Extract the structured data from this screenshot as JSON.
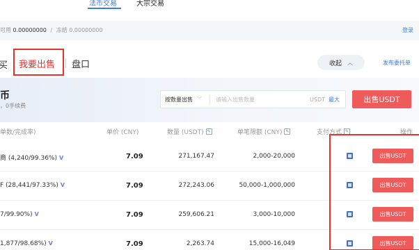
{
  "top_tabs": {
    "fiat": "法币交易",
    "bulk": "大宗交易"
  },
  "balance": {
    "available_label": "可用",
    "available_value": "0.00000000",
    "separator": "/",
    "frozen_label": "冻结",
    "frozen_value": "0.00000000",
    "record_link": "登录"
  },
  "mode_tabs": {
    "left_cut": "买",
    "sell": "我要出售",
    "book": "盘口"
  },
  "collapse": {
    "label": "收起",
    "icon": "chevron-up"
  },
  "post_order": "发布委托单",
  "coin": {
    "name": "币",
    "fee_text": "，0手续费"
  },
  "sell_form": {
    "type_label": "按数量出售",
    "amount_placeholder": "请输入出售数量",
    "unit": "USDT",
    "max_label": "最大",
    "submit_label": "出售USDT"
  },
  "table": {
    "headers": {
      "merchant": "单数/完成率)",
      "price": "单价 (CNY)",
      "amount": "数量 (USDT)",
      "limit": "单笔限额 (CNY)",
      "payment": "支付方式",
      "action": "操作"
    },
    "rows": [
      {
        "merchant": "商 (4,240/99.36%)",
        "verified": "V",
        "price": "7.09",
        "amount": "271,167.47",
        "limit": "2,000-20,000",
        "action": "出售USDT"
      },
      {
        "merchant": "F (28,441/97.33%)",
        "verified": "V",
        "price": "7.09",
        "amount": "272,243.06",
        "limit": "50,000-1,000,000",
        "action": "出售USDT"
      },
      {
        "merchant": "7/99.90%)",
        "verified": "V",
        "price": "7.09",
        "amount": "259,606.21",
        "limit": "3,000-10,000",
        "action": "出售USDT"
      },
      {
        "merchant": "1,877/98.68%)",
        "verified": "V",
        "price": "7.09",
        "amount": "2,263.74",
        "limit": "15,000-16,049",
        "action": "出售USDT"
      }
    ]
  },
  "colors": {
    "accent_blue": "#3b7ddd",
    "sell_red": "#ef5a5a",
    "highlight_red": "#e8302c"
  }
}
